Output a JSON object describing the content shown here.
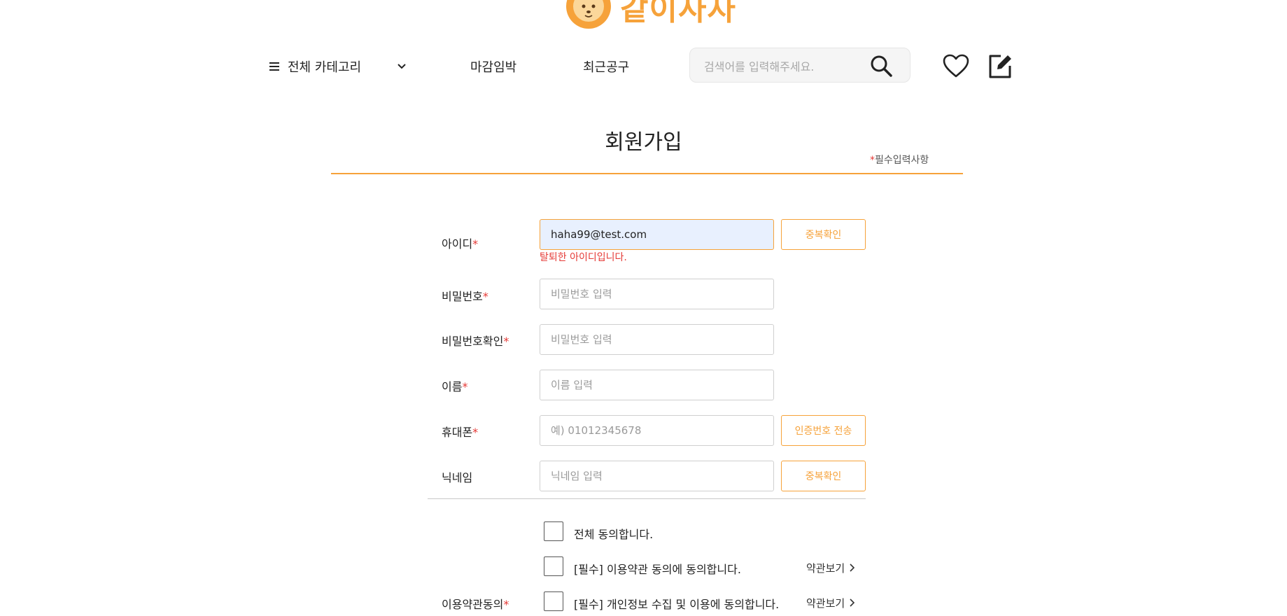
{
  "logo": {
    "text": "같이사자",
    "icon": "lion-logo-icon"
  },
  "nav": {
    "category_label": "전체 카테고리",
    "menu_icon": "hamburger-menu-icon",
    "chevron_icon": "chevron-down-icon",
    "link1": "마감임박",
    "link2": "최근공구",
    "search_placeholder": "검색어를 입력해주세요.",
    "search_icon": "search-icon",
    "wishlist_icon": "heart-icon",
    "write_icon": "edit-icon"
  },
  "page": {
    "title": "회원가입",
    "required_star": "*",
    "required_note": "필수입력사항"
  },
  "form": {
    "id": {
      "label": "아이디",
      "value": "haha99@test.com",
      "button": "중복확인",
      "error": "탈퇴한 아이디입니다."
    },
    "password": {
      "label": "비밀번호",
      "placeholder": "비밀번호 입력"
    },
    "password_confirm": {
      "label": "비밀번호확인",
      "placeholder": "비밀번호 입력"
    },
    "name": {
      "label": "이름",
      "placeholder": "이름 입력"
    },
    "phone": {
      "label": "휴대폰",
      "placeholder": "예) 01012345678",
      "button": "인증번호 전송"
    },
    "nickname": {
      "label": "닉네임",
      "placeholder": "닉네임 입력",
      "button": "중복확인"
    },
    "star": "*"
  },
  "terms": {
    "label": "이용약관동의",
    "agree_all": "전체 동의합니다.",
    "agree_terms": "[필수] 이용약관 동의에 동의합니다.",
    "agree_privacy": "[필수] 개인정보 수집 및 이용에 동의합니다.",
    "view_link": "약관보기",
    "view_icon": "chevron-right-icon"
  },
  "colors": {
    "accent": "#f6a23a",
    "error": "#e53935",
    "autofill": "#e8f0fe"
  }
}
